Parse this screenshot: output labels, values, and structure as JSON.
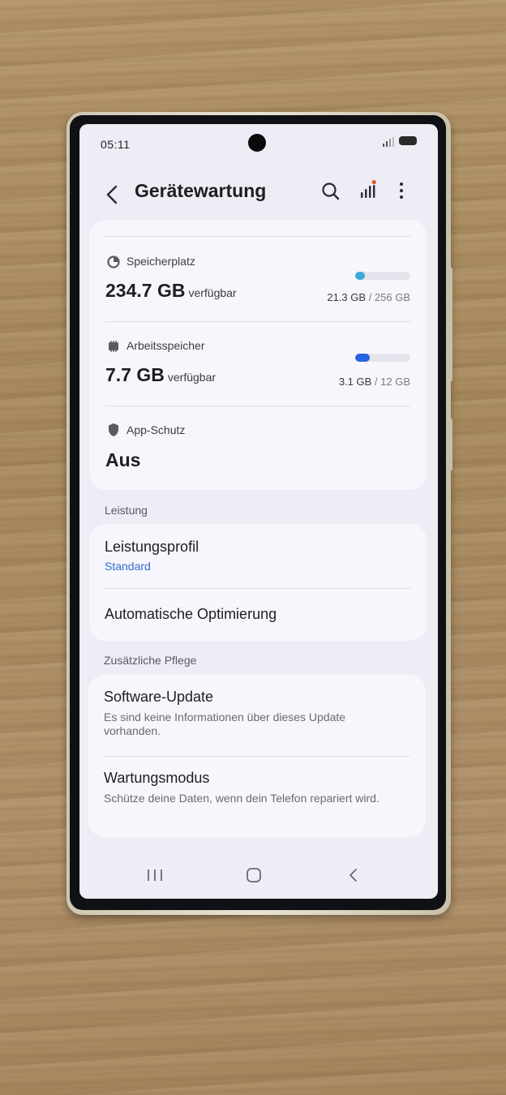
{
  "status_bar": {
    "time": "05:11"
  },
  "app_bar": {
    "title": "Gerätewartung"
  },
  "storage": {
    "label": "Speicherplatz",
    "available_value": "234.7 GB",
    "available_suffix": "verfügbar",
    "used": "21.3 GB",
    "total": "/ 256 GB",
    "used_fraction": 0.083,
    "bar_color": "#3aa9d8"
  },
  "memory": {
    "label": "Arbeitsspeicher",
    "available_value": "7.7 GB",
    "available_suffix": "verfügbar",
    "used": "3.1 GB",
    "total": "/ 12 GB",
    "used_fraction": 0.26,
    "bar_color": "#2563e0"
  },
  "app_protection": {
    "label": "App-Schutz",
    "value": "Aus"
  },
  "performance": {
    "header": "Leistung",
    "profile_title": "Leistungsprofil",
    "profile_value": "Standard",
    "auto_opt_title": "Automatische Optimierung"
  },
  "extra_care": {
    "header": "Zusätzliche Pflege",
    "software_update_title": "Software-Update",
    "software_update_sub": "Es sind keine Informationen über dieses Update vorhanden.",
    "maintenance_title": "Wartungsmodus",
    "maintenance_sub": "Schütze deine Daten, wenn dein Telefon repariert wird."
  },
  "icons": {
    "back": "chevron-left-icon",
    "search": "search-icon",
    "stats": "signal-bars-icon",
    "more": "more-vert-icon",
    "storage": "pie-chart-icon",
    "memory": "chip-icon",
    "protection": "shield-icon",
    "nav_recents": "recents-icon",
    "nav_home": "home-icon",
    "nav_back": "nav-back-icon"
  },
  "colors": {
    "accent": "#2f6ad3",
    "stats_dot": "#e05a2b"
  }
}
